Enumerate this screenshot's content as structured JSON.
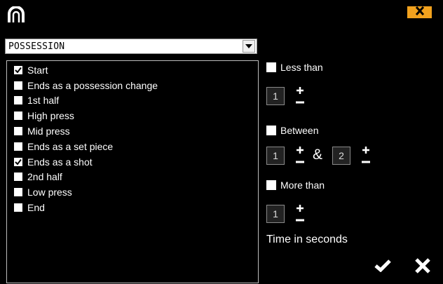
{
  "header": {
    "logo_icon": "arch-logo-icon",
    "close_icon": "close-icon",
    "close_color": "#f2a21e"
  },
  "dropdown": {
    "value": "POSSESSION",
    "icon": "chevron-down-icon"
  },
  "events": {
    "items": [
      {
        "label": "Start",
        "checked": true
      },
      {
        "label": "Ends as a possession change",
        "checked": false
      },
      {
        "label": "1st half",
        "checked": false
      },
      {
        "label": "High press",
        "checked": false
      },
      {
        "label": "Mid press",
        "checked": false
      },
      {
        "label": "Ends as a set piece",
        "checked": false
      },
      {
        "label": "Ends as a shot",
        "checked": true
      },
      {
        "label": "2nd half",
        "checked": false
      },
      {
        "label": "Low press",
        "checked": false
      },
      {
        "label": "End",
        "checked": false
      }
    ]
  },
  "filters": {
    "less_than": {
      "label": "Less than",
      "checked": false,
      "value": "1"
    },
    "between": {
      "label": "Between",
      "checked": false,
      "from": "1",
      "separator": "&",
      "to": "2"
    },
    "more_than": {
      "label": "More than",
      "checked": false,
      "value": "1"
    },
    "unit_label": "Time in seconds"
  },
  "actions": {
    "confirm_icon": "check-icon",
    "cancel_icon": "close-icon"
  }
}
